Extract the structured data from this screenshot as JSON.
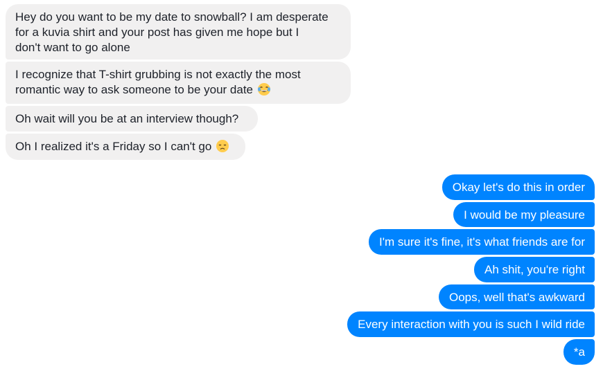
{
  "messages": {
    "received": [
      {
        "lines": [
          "Hey do you want to be my date to snowball? I am desperate",
          "for a kuvia shirt and your post has given me hope but I",
          "don't want to go alone"
        ]
      },
      {
        "lines": [
          "I recognize that T-shirt grubbing is not exactly the most",
          "romantic way to ask someone to be your date"
        ],
        "emoji": "tears-of-joy-emoji"
      },
      {
        "lines": [
          "Oh wait will you be at an interview though?"
        ]
      },
      {
        "lines": [
          "Oh I realized it's a Friday so I can't go"
        ],
        "emoji": "disappointed-emoji"
      }
    ],
    "sent": [
      {
        "text": "Okay let's do this in order"
      },
      {
        "text": "I would be my pleasure"
      },
      {
        "text": "I'm sure it's fine, it's what friends are for"
      },
      {
        "text": "Ah shit, you're right"
      },
      {
        "text": "Oops, well that's awkward"
      },
      {
        "text": "Every interaction with you is such I wild ride"
      },
      {
        "text": "*a"
      }
    ]
  },
  "colors": {
    "received_bubble": "#f1f0f0",
    "sent_bubble": "#0084ff"
  }
}
